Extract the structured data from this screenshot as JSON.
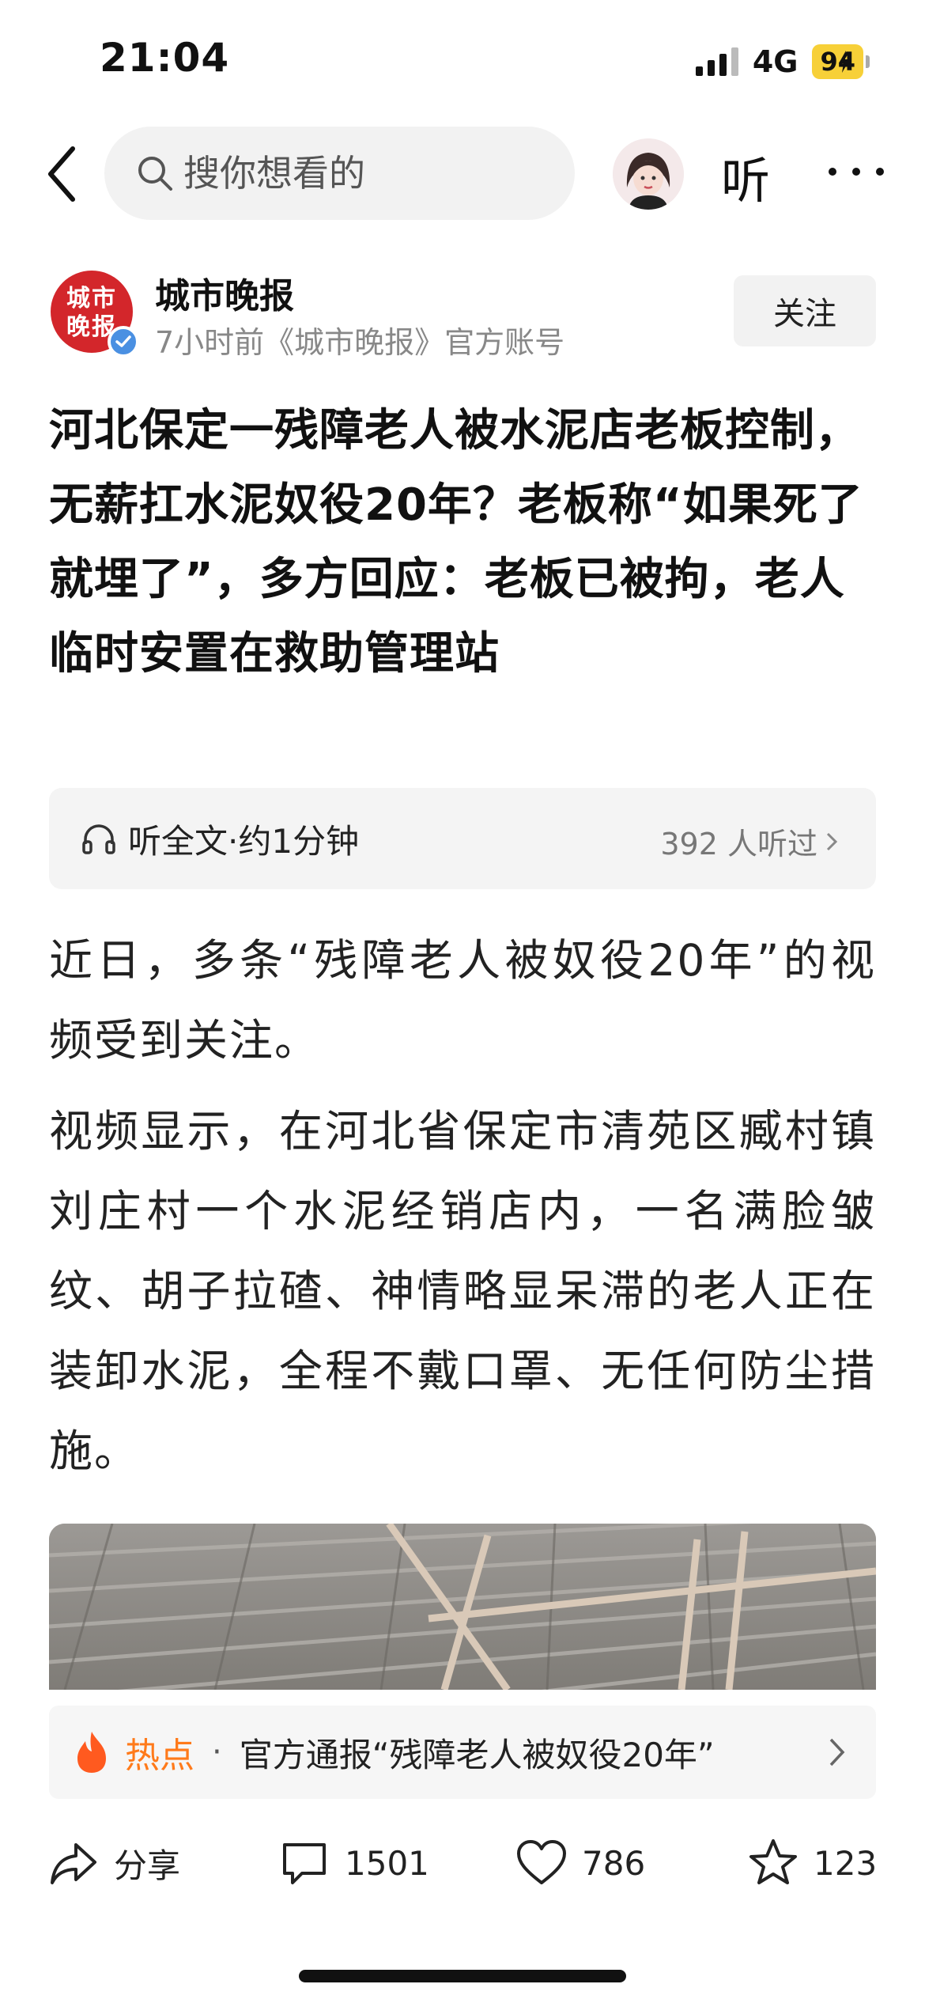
{
  "status_bar": {
    "time": "21:04",
    "network": "4G",
    "battery": "94"
  },
  "nav": {
    "search_placeholder": "搜你想看的",
    "listen_label": "听"
  },
  "author": {
    "name": "城市晚报",
    "meta": "7小时前《城市晚报》官方账号",
    "logo_text": "城市晚报",
    "follow_label": "关注"
  },
  "article": {
    "headline": "河北保定一残障老人被水泥店老板控制，无薪扛水泥奴役20年？老板称“如果死了就埋了”，多方回应：老板已被拘，老人临时安置在救助管理站",
    "listen_bar": {
      "label": "听全文·约1分钟",
      "count": "392 人听过"
    },
    "paragraphs": [
      "近日，多条“残障老人被奴役20年”的视频受到关注。",
      "视频显示，在河北省保定市清苑区臧村镇刘庄村一个水泥经销店内，一名满脸皱纹、胡子拉碴、神情略显呆滞的老人正在装卸水泥，全程不戴口罩、无任何防尘措施。"
    ]
  },
  "hot_banner": {
    "label": "热点",
    "separator": "·",
    "text": "官方通报“残障老人被奴役20年”"
  },
  "actions": {
    "share_label": "分享",
    "comments": "1501",
    "likes": "786",
    "favorites": "123"
  },
  "colors": {
    "hot_orange": "#ff7a1a",
    "brand_red": "#d3262b",
    "verified_blue": "#4a90e2"
  }
}
